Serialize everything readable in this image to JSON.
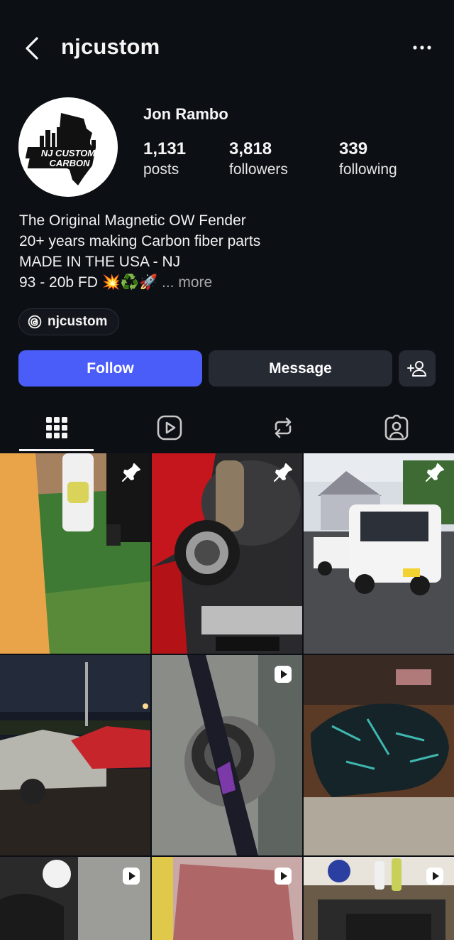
{
  "header": {
    "username": "njcustom",
    "back_icon": "chevron-left-icon",
    "menu_icon": "more-horizontal-icon"
  },
  "profile": {
    "display_name": "Jon Rambo",
    "avatar_logo_lines": [
      "NJ CUSTOM",
      "CARBON"
    ],
    "stats": [
      {
        "value": "1,131",
        "label": "posts"
      },
      {
        "value": "3,818",
        "label": "followers"
      },
      {
        "value": "339",
        "label": "following"
      }
    ],
    "bio": [
      "The Original Magnetic OW Fender",
      "20+ years making Carbon fiber parts",
      "MADE IN THE USA - NJ"
    ],
    "bio_last_line": "93 - 20b FD 💥♻️🚀",
    "bio_more": "... more",
    "threads_handle": "njcustom"
  },
  "actions": {
    "follow": "Follow",
    "message": "Message",
    "add_user_icon": "add-person-icon"
  },
  "tabs": [
    {
      "name": "grid",
      "icon": "grid-icon",
      "active": true
    },
    {
      "name": "reels",
      "icon": "reels-icon",
      "active": false
    },
    {
      "name": "reposts",
      "icon": "repost-icon",
      "active": false
    },
    {
      "name": "tagged",
      "icon": "tagged-person-icon",
      "active": false
    }
  ],
  "posts": [
    {
      "subject": "golf bag on putting green",
      "badge": "pin"
    },
    {
      "subject": "turbo engine bay",
      "badge": "pin"
    },
    {
      "subject": "white mini truck",
      "badge": "pin"
    },
    {
      "subject": "cars parked at night",
      "badge": "none"
    },
    {
      "subject": "carbon fender detail",
      "badge": "reel"
    },
    {
      "subject": "hydro-dipped carbon part",
      "badge": "reel"
    },
    {
      "subject": "motorcycle",
      "badge": "reel"
    },
    {
      "subject": "mesh fabric",
      "badge": "reel"
    },
    {
      "subject": "workshop tools",
      "badge": "reel"
    }
  ],
  "colors": {
    "background": "#0c0f14",
    "follow_button": "#4a5df9",
    "secondary_button": "#262a33"
  }
}
